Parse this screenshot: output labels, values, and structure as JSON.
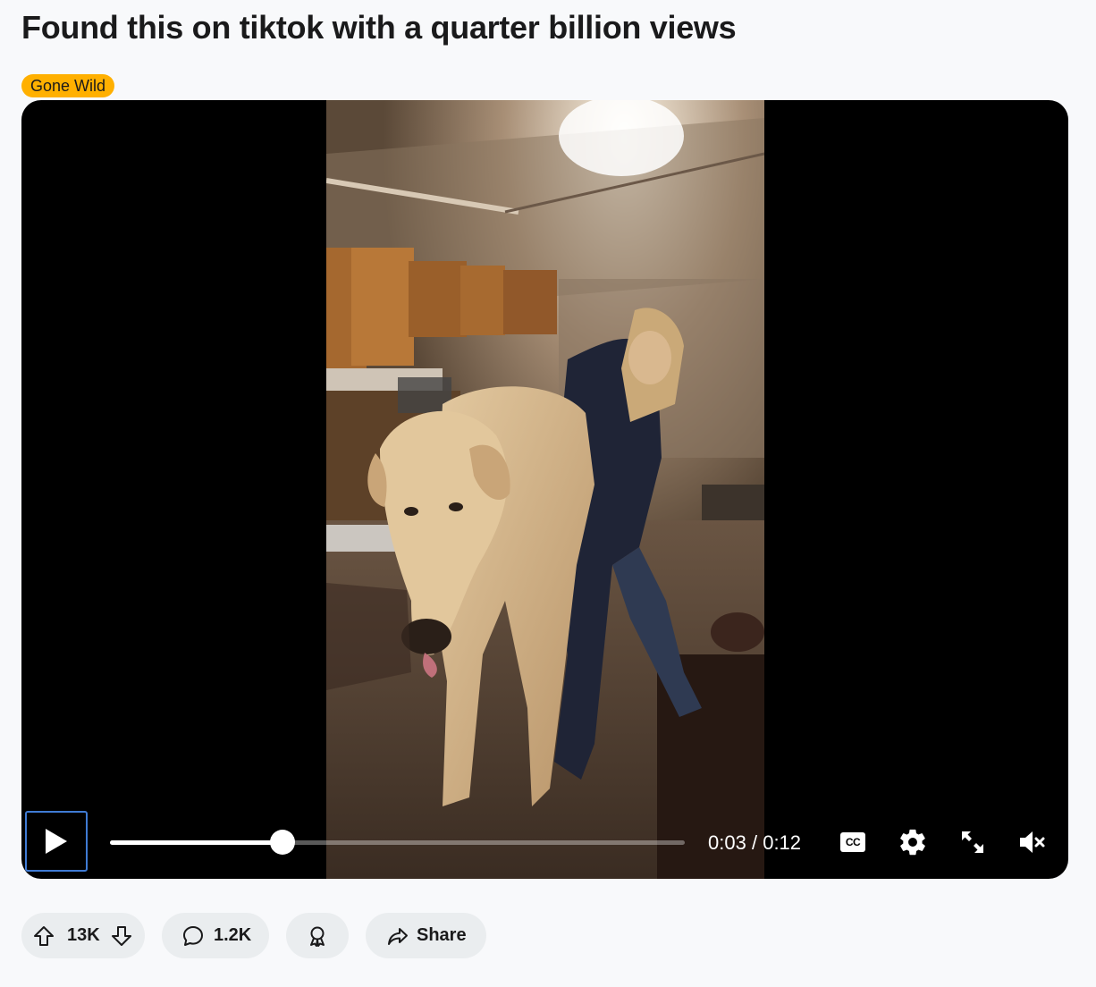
{
  "post": {
    "title": "Found this on tiktok with a quarter billion views",
    "flair": "Gone Wild"
  },
  "player": {
    "progress": 0.3,
    "time_current": "0:03",
    "time_separator": "/",
    "time_total": "0:12",
    "cc_label": "CC",
    "icons": {
      "play": "play-icon",
      "captions": "captions-icon",
      "settings": "gear-icon",
      "fullscreen": "fullscreen-icon",
      "volume": "muted-speaker-icon"
    }
  },
  "actions": {
    "upvote_count": "13K",
    "comment_count": "1.2K",
    "share_label": "Share",
    "icons": {
      "upvote": "upvote-arrow-icon",
      "downvote": "downvote-arrow-icon",
      "comment": "comment-bubble-icon",
      "award": "award-icon",
      "share": "share-arrow-icon"
    }
  },
  "colors": {
    "flair_background": "#ffb000",
    "page_background": "#f8f9fb",
    "action_pill_background": "#eaedef",
    "focus_outline": "#3f7bd4"
  }
}
